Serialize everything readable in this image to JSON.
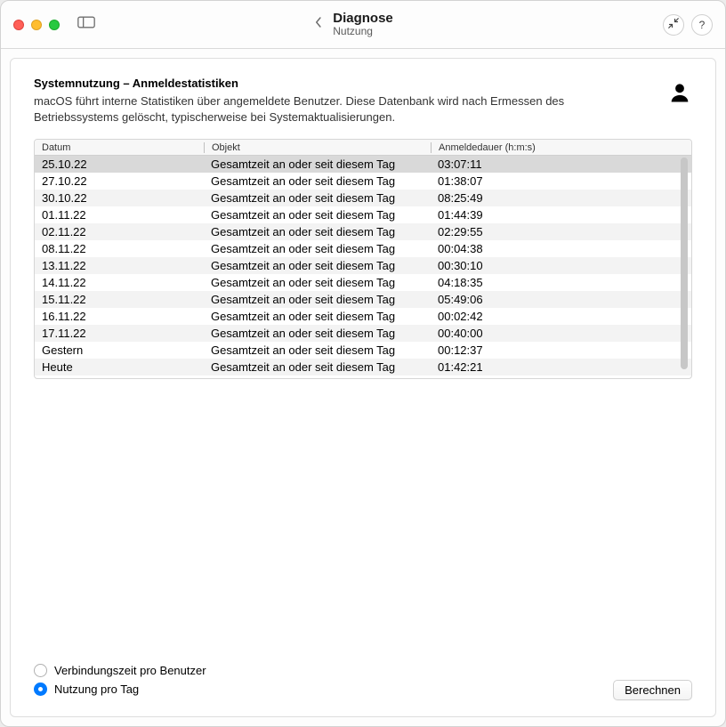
{
  "window": {
    "title": "Diagnose",
    "subtitle": "Nutzung"
  },
  "section": {
    "title": "Systemnutzung – Anmeldestatistiken",
    "description": "macOS führt interne Statistiken über angemeldete Benutzer. Diese Datenbank wird nach Ermessen des Betriebssystems gelöscht, typischerweise bei Systemaktualisierungen."
  },
  "columns": {
    "date": "Datum",
    "object": "Objekt",
    "duration": "Anmeldedauer (h:m:s)"
  },
  "rows": [
    {
      "date": "25.10.22",
      "object": "Gesamtzeit an oder seit diesem Tag",
      "duration": "03:07:11",
      "selected": true
    },
    {
      "date": "27.10.22",
      "object": "Gesamtzeit an oder seit diesem Tag",
      "duration": "01:38:07"
    },
    {
      "date": "30.10.22",
      "object": "Gesamtzeit an oder seit diesem Tag",
      "duration": "08:25:49"
    },
    {
      "date": "01.11.22",
      "object": "Gesamtzeit an oder seit diesem Tag",
      "duration": "01:44:39"
    },
    {
      "date": "02.11.22",
      "object": "Gesamtzeit an oder seit diesem Tag",
      "duration": "02:29:55"
    },
    {
      "date": "08.11.22",
      "object": "Gesamtzeit an oder seit diesem Tag",
      "duration": "00:04:38"
    },
    {
      "date": "13.11.22",
      "object": "Gesamtzeit an oder seit diesem Tag",
      "duration": "00:30:10"
    },
    {
      "date": "14.11.22",
      "object": "Gesamtzeit an oder seit diesem Tag",
      "duration": "04:18:35"
    },
    {
      "date": "15.11.22",
      "object": "Gesamtzeit an oder seit diesem Tag",
      "duration": "05:49:06"
    },
    {
      "date": "16.11.22",
      "object": "Gesamtzeit an oder seit diesem Tag",
      "duration": "00:02:42"
    },
    {
      "date": "17.11.22",
      "object": "Gesamtzeit an oder seit diesem Tag",
      "duration": "00:40:00"
    },
    {
      "date": "Gestern",
      "object": "Gesamtzeit an oder seit diesem Tag",
      "duration": "00:12:37"
    },
    {
      "date": "Heute",
      "object": "Gesamtzeit an oder seit diesem Tag",
      "duration": "01:42:21"
    }
  ],
  "options": {
    "per_user": "Verbindungszeit pro Benutzer",
    "per_day": "Nutzung pro Tag",
    "selected": "per_day"
  },
  "buttons": {
    "compute": "Berechnen",
    "help": "?"
  },
  "icons": {
    "collapse": "⤡"
  }
}
